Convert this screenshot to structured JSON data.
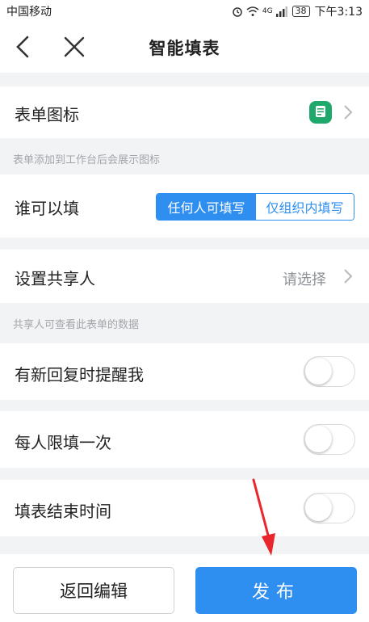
{
  "status_bar": {
    "carrier": "中国移动",
    "network": "4G",
    "battery": "38",
    "time": "下午3:13"
  },
  "nav": {
    "title": "智能填表",
    "back_icon": "chevron-left-icon",
    "close_icon": "close-icon"
  },
  "form_icon": {
    "label": "表单图标",
    "hint": "表单添加到工作台后会展示图标",
    "icon_color": "#1fa86b"
  },
  "who_can_fill": {
    "label": "谁可以填",
    "options": [
      "任何人可填写",
      "仅组织内填写"
    ],
    "selected": "任何人可填写"
  },
  "share": {
    "label": "设置共享人",
    "placeholder": "请选择",
    "hint": "共享人可查看此表单的数据"
  },
  "toggles": [
    {
      "label": "有新回复时提醒我",
      "on": false
    },
    {
      "label": "每人限填一次",
      "on": false
    },
    {
      "label": "填表结束时间",
      "on": false
    }
  ],
  "footer": {
    "back_edit": "返回编辑",
    "publish": "发布"
  },
  "colors": {
    "accent": "#2f8ff0",
    "annotation_arrow": "#e8262b"
  }
}
